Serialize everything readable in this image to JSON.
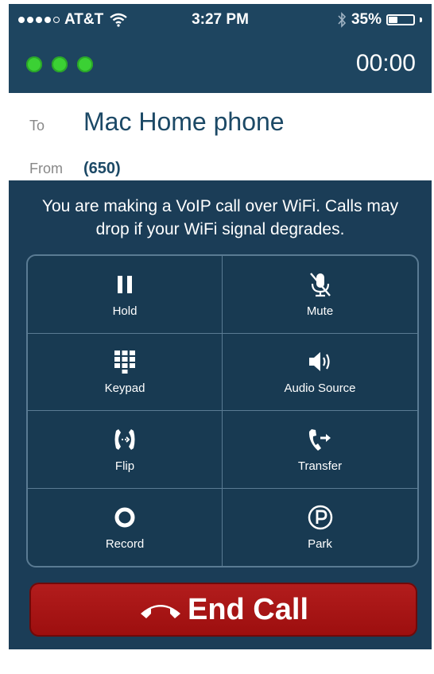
{
  "status_bar": {
    "carrier": "AT&T",
    "time": "3:27 PM",
    "battery_text": "35%",
    "battery_level": 0.35,
    "signal_bars": 4
  },
  "call": {
    "duration": "00:00",
    "indicator_color": "#3bd134"
  },
  "party": {
    "to_label": "To",
    "to_value": "Mac Home phone",
    "from_label": "From",
    "from_value": "(650)"
  },
  "notice": "You are making a VoIP call over WiFi. Calls may drop if your WiFi signal degrades.",
  "controls": [
    {
      "label": "Hold",
      "icon": "pause-icon"
    },
    {
      "label": "Mute",
      "icon": "mic-muted-icon"
    },
    {
      "label": "Keypad",
      "icon": "keypad-icon"
    },
    {
      "label": "Audio Source",
      "icon": "speaker-icon"
    },
    {
      "label": "Flip",
      "icon": "flip-phone-icon"
    },
    {
      "label": "Transfer",
      "icon": "transfer-phone-icon"
    },
    {
      "label": "Record",
      "icon": "record-icon"
    },
    {
      "label": "Park",
      "icon": "park-icon"
    }
  ],
  "end_call": {
    "label": "End Call",
    "icon": "hangup-icon",
    "color": "#a81515"
  },
  "colors": {
    "header": "#1e4560",
    "panel": "#1b3d57",
    "accent_text": "#1c4966"
  }
}
